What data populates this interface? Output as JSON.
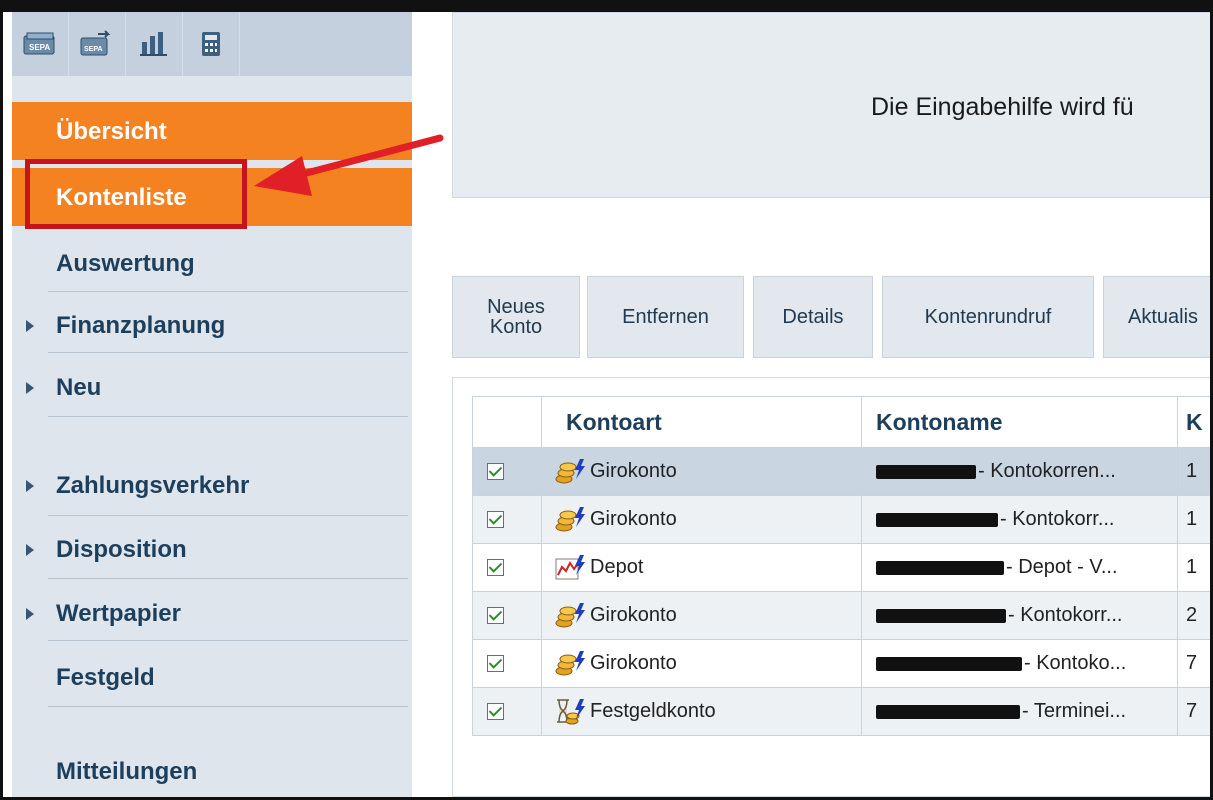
{
  "toolbar": {
    "icons": [
      "sepa-icon",
      "sepa-transfer-icon",
      "bar-chart-icon",
      "calculator-icon"
    ]
  },
  "sidebar": {
    "items": [
      {
        "label": "Übersicht"
      },
      {
        "label": "Kontenliste"
      },
      {
        "label": "Auswertung"
      },
      {
        "label": "Finanzplanung"
      },
      {
        "label": "Neu"
      },
      {
        "label": "Zahlungsverkehr"
      },
      {
        "label": "Disposition"
      },
      {
        "label": "Wertpapier"
      },
      {
        "label": "Festgeld"
      },
      {
        "label": "Mitteilungen"
      }
    ]
  },
  "banner": {
    "text": "Die Eingabehilfe wird fü"
  },
  "actions": {
    "new_account": "Neues Konto",
    "remove": "Entfernen",
    "details": "Details",
    "account_poll": "Kontenrundruf",
    "refresh": "Aktualis"
  },
  "table": {
    "columns": [
      "",
      "Kontoart",
      "Kontoname",
      "K"
    ],
    "rows": [
      {
        "type": "Girokonto",
        "icon": "coins-icon",
        "name": "- Kontokorren...",
        "num": "1"
      },
      {
        "type": "Girokonto",
        "icon": "coins-icon",
        "name": "- Kontokorr...",
        "num": "1"
      },
      {
        "type": "Depot",
        "icon": "depot-chart-icon",
        "name": "- Depot - V...",
        "num": "1"
      },
      {
        "type": "Girokonto",
        "icon": "coins-icon",
        "name": "- Kontokorr...",
        "num": "2"
      },
      {
        "type": "Girokonto",
        "icon": "coins-icon",
        "name": "- Kontoko...",
        "num": "7"
      },
      {
        "type": "Festgeldkonto",
        "icon": "hourglass-coins-icon",
        "name": "- Terminei...",
        "num": "7"
      }
    ]
  },
  "colors": {
    "accent": "#f58220",
    "highlight": "#c4141d",
    "sidebar_bg": "#dfe5ec",
    "selected_row": "#c9d5e1"
  }
}
